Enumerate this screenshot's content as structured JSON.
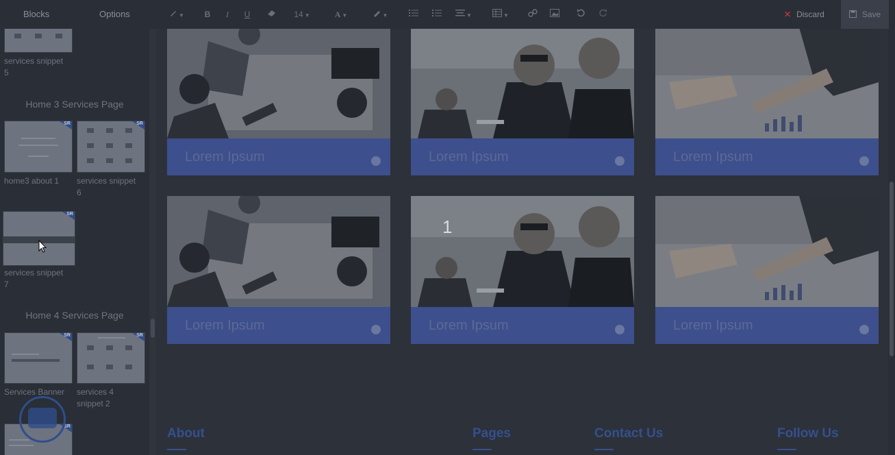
{
  "toolbar": {
    "tabs": [
      "Blocks",
      "Options"
    ],
    "font_size": "14",
    "discard_label": "Discard",
    "save_label": "Save"
  },
  "sidebar": {
    "top_item": {
      "label_line1": "services snippet",
      "label_line2": "5"
    },
    "groups": [
      {
        "title": "Home 3 Services Page",
        "items": [
          {
            "label_line1": "home3 about 1",
            "label_line2": ""
          },
          {
            "label_line1": "services snippet",
            "label_line2": "6"
          },
          {
            "label_line1": "services snippet",
            "label_line2": "7"
          }
        ]
      },
      {
        "title": "Home 4 Services Page",
        "items": [
          {
            "label_line1": "Services Banner",
            "label_line2": ""
          },
          {
            "label_line1": "services 4",
            "label_line2": "snippet 2"
          }
        ]
      }
    ],
    "thumb_badge": "SR"
  },
  "main": {
    "cards": [
      {
        "title": "Lorem Ipsum",
        "image": "meeting-table-photo"
      },
      {
        "title": "Lorem Ipsum",
        "image": "business-men-photo"
      },
      {
        "title": "Lorem Ipsum",
        "image": "chart-hand-photo"
      },
      {
        "title": "Lorem Ipsum",
        "image": "meeting-table-photo"
      },
      {
        "title": "Lorem Ipsum",
        "image": "business-men-photo"
      },
      {
        "title": "Lorem Ipsum",
        "image": "chart-hand-photo"
      }
    ],
    "overlay_number": "1",
    "footer": [
      "About",
      "Pages",
      "Contact Us",
      "Follow Us"
    ]
  },
  "colors": {
    "accent": "#34508f",
    "band": "#3d4f8c",
    "discard": "#a5393e"
  }
}
